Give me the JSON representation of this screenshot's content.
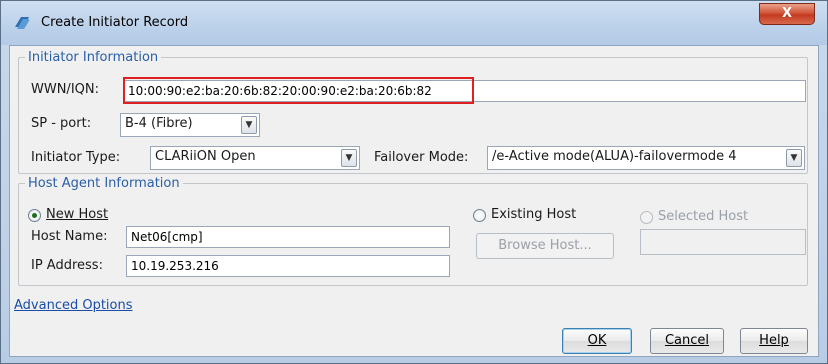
{
  "window": {
    "title": "Create Initiator Record",
    "close_glyph": "X"
  },
  "initiator_info": {
    "group_title": "Initiator Information",
    "wwn_label": "WWN/IQN:",
    "wwn_value": "10:00:90:e2:ba:20:6b:82:20:00:90:e2:ba:20:6b:82",
    "sp_port_label": "SP - port:",
    "sp_port_value": "B-4 (Fibre)",
    "initiator_type_label": "Initiator Type:",
    "initiator_type_value": "CLARiiON Open",
    "failover_mode_label": "Failover Mode:",
    "failover_mode_value": "/e-Active mode(ALUA)-failovermode 4"
  },
  "host_agent": {
    "group_title": "Host Agent Information",
    "new_host_label": "New Host",
    "existing_host_label": "Existing Host",
    "selected_host_label": "Selected Host",
    "host_name_label": "Host Name:",
    "host_name_value": "Net06[cmp]",
    "ip_address_label": "IP Address:",
    "ip_address_value": "10.19.253.216",
    "browse_host_label": "Browse Host...",
    "selected_option": "New Host"
  },
  "links": {
    "advanced_options": "Advanced Options"
  },
  "buttons": {
    "ok": "OK",
    "cancel": "Cancel",
    "help": "Help"
  },
  "colors": {
    "highlight": "#e02020",
    "group_title": "#2a5ea8",
    "link": "#1a4ca8"
  },
  "icons": {
    "title": "app-window-icon",
    "close": "close-icon",
    "dropdown": "chevron-down-icon"
  }
}
